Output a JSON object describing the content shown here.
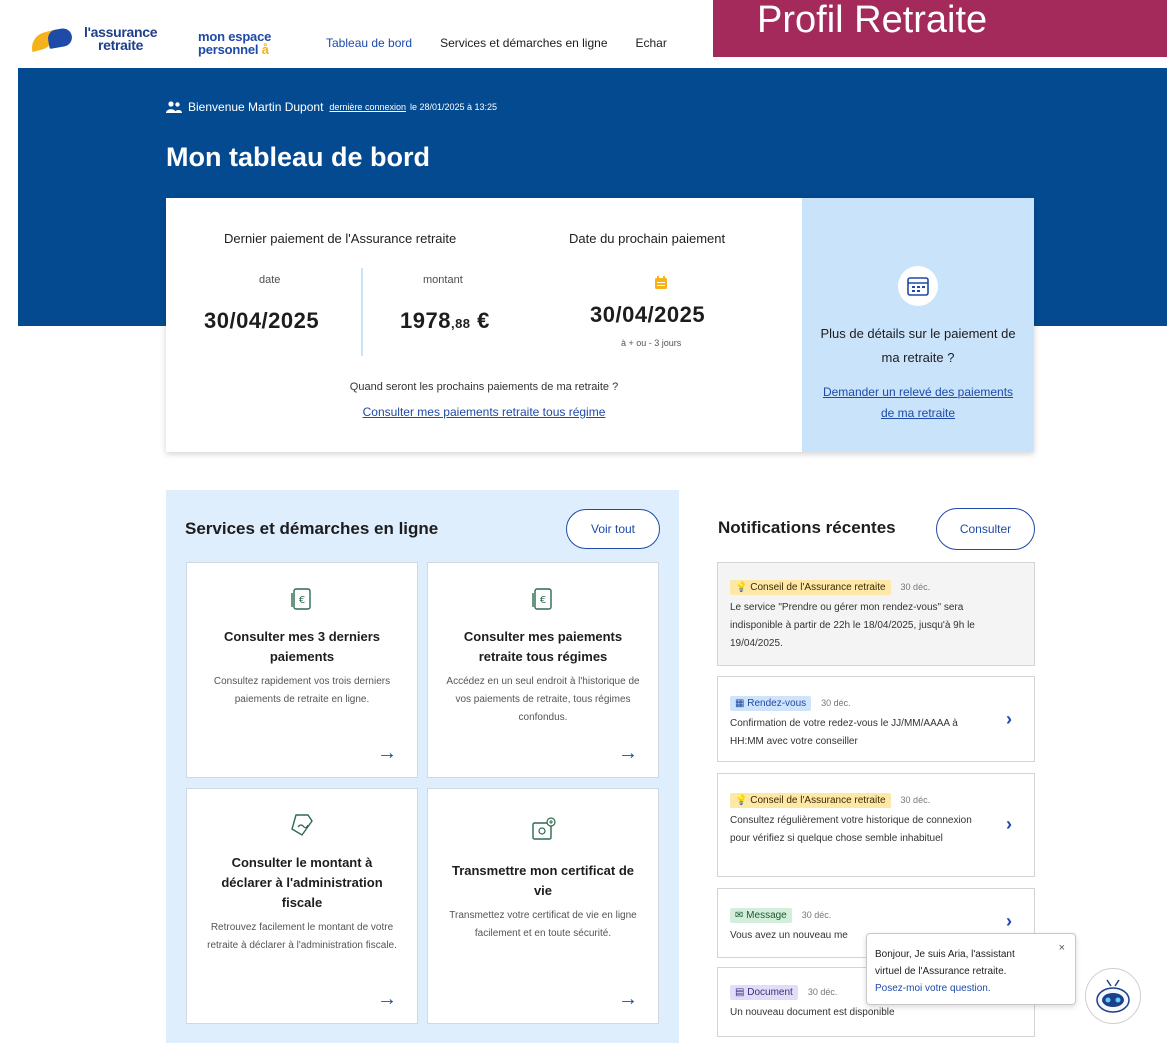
{
  "header": {
    "logo_line1": "l'assurance",
    "logo_line2": "retraite",
    "espace_line1": "mon espace",
    "espace_line2": "personnel",
    "nav": [
      "Tableau de bord",
      "Services et démarches en ligne",
      "Echar"
    ],
    "profile_banner": "Profil Retraite"
  },
  "welcome": {
    "text": "Bienvenue Martin Dupont",
    "link": "dernière connexion",
    "date": "le 28/01/2025 à 13:25"
  },
  "page_title": "Mon tableau de bord",
  "payment": {
    "last_heading": "Dernier paiement de l'Assurance retraite",
    "date_label": "date",
    "date_value": "30/04/2025",
    "amount_label": "montant",
    "amount_whole": "1978",
    "amount_cents": ",88",
    "amount_currency": " €",
    "next_heading": "Date du prochain paiement",
    "next_value": "30/04/2025",
    "next_sub": "à + ou - 3 jours",
    "question": "Quand seront les prochains paiements de ma retraite ?",
    "link": "Consulter mes paiements retraite tous régime",
    "side_title": "Plus de détails sur le paiement de ma retraite ?",
    "side_link": "Demander un relevé des paiements de ma retraite"
  },
  "services": {
    "title": "Services et démarches en ligne",
    "see_all": "Voir tout",
    "cards": [
      {
        "title": "Consulter mes 3 derniers paiements",
        "desc": "Consultez rapidement vos trois derniers paiements de retraite en ligne."
      },
      {
        "title": "Consulter mes paiements retraite tous régimes",
        "desc": "Accédez en un seul endroit à l'historique de vos paiements de retraite, tous régimes confondus."
      },
      {
        "title": "Consulter le montant à déclarer à l'administration fiscale",
        "desc": "Retrouvez facilement le montant de votre retraite à déclarer à l'administration fiscale."
      },
      {
        "title": "Transmettre mon certificat de vie",
        "desc": "Transmettez votre certificat de vie en ligne facilement et en toute sécurité."
      }
    ]
  },
  "notifications": {
    "title": "Notifications récentes",
    "consult": "Consulter",
    "items": [
      {
        "tag": "Conseil de l'Assurance retraite",
        "date": "30 déc.",
        "body": "Le service \"Prendre ou gérer mon rendez-vous\" sera indisponible à partir de 22h le 18/04/2025, jusqu'à 9h le 19/04/2025."
      },
      {
        "tag": "Rendez-vous",
        "date": "30 déc.",
        "body": "Confirmation de votre redez-vous le JJ/MM/AAAA à HH:MM avec votre conseiller"
      },
      {
        "tag": "Conseil de l'Assurance retraite",
        "date": "30 déc.",
        "body": "Consultez régulièrement votre historique de connexion pour vérifiez si quelque chose semble inhabituel"
      },
      {
        "tag": "Message",
        "date": "30 déc.",
        "body": "Vous avez un nouveau me"
      },
      {
        "tag": "Document",
        "date": "30 déc.",
        "body": "Un nouveau document est disponible"
      }
    ]
  },
  "bot": {
    "line1": "Bonjour, Je suis Aria, l'assistant",
    "line2": "virtuel de l'Assurance retraite.",
    "link": "Posez-moi votre question.",
    "close": "×"
  },
  "colors": {
    "brand_blue": "#044a91",
    "link_blue": "#1e4aa8",
    "banner": "#a32a5a",
    "light_blue": "#c9e3fb"
  }
}
